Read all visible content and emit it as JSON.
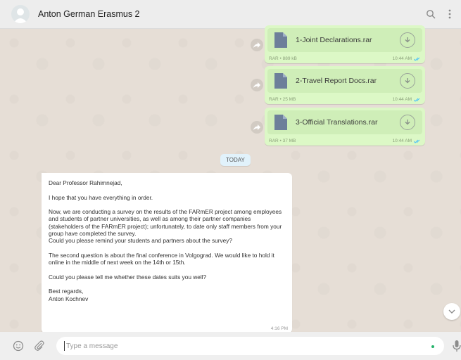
{
  "header": {
    "title": "Anton German Erasmus 2",
    "icons": [
      "avatar",
      "search-icon",
      "menu-icon"
    ]
  },
  "files": [
    {
      "name": "1-Joint Declarations.rar",
      "meta": "RAR • 889 kB",
      "time": "10:44 AM"
    },
    {
      "name": "2-Travel Report Docs.rar",
      "meta": "RAR • 25 MB",
      "time": "10:44 AM"
    },
    {
      "name": "3-Official Translations.rar",
      "meta": "RAR • 37 MB",
      "time": "10:44 AM"
    }
  ],
  "date_chip": "TODAY",
  "message": {
    "greeting": "Dear Professor Rahimnejad,",
    "p1": "I hope that you have everything in order.",
    "p2": "Now, we are conducting a survey on the results of the FARmER project among employees and students of partner universities, as well as among their partner companies (stakeholders of the FARmER project); unfortunately, to date only staff members from your group have completed the survey.\nCould you please remind your students and partners about the survey?",
    "p3": "The second question is about the final conference in Volgograd. We would like to hold it online in the middle of next week on the 14th or 15th.",
    "p4": "Could you please tell me whether these dates suits you well?",
    "signoff": "Best regards,\nAnton Kochnev",
    "time": "4:16 PM"
  },
  "composer": {
    "placeholder": "Type a message"
  },
  "colors": {
    "outgoing_bubble": "#dcf8c6",
    "incoming_bubble": "#ffffff",
    "background": "#e5ddd5",
    "read_ticks": "#4fc3f7"
  }
}
